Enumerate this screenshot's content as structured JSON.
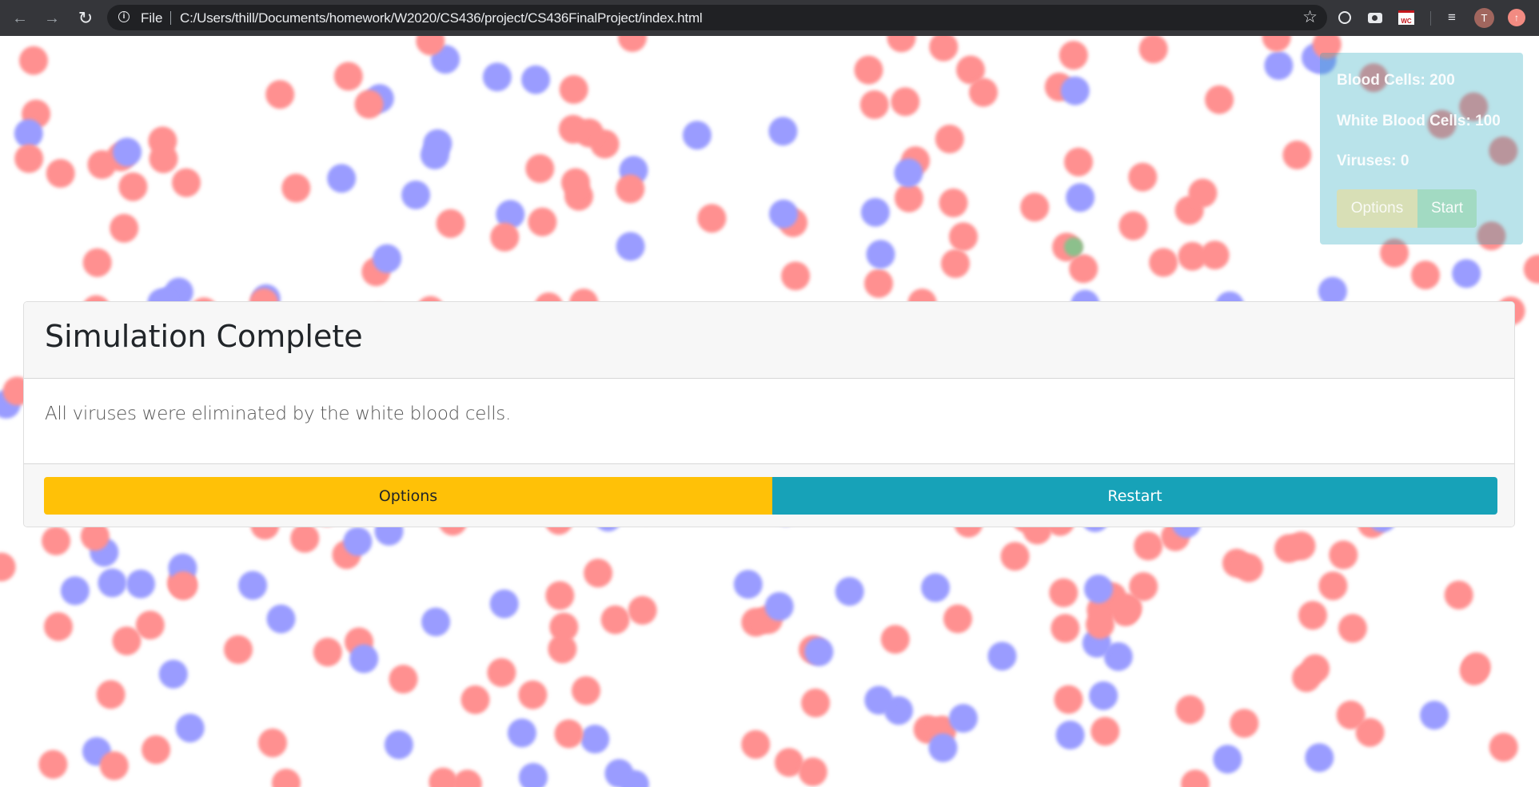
{
  "browser": {
    "scheme_label": "File",
    "url": "C:/Users/thill/Documents/homework/W2020/CS436/project/CS436FinalProject/index.html",
    "profile_initial": "T",
    "extensions": [
      "circle-extension-icon",
      "camera-icon",
      "wc-extension-icon",
      "media-control-icon"
    ]
  },
  "stats": {
    "blood_cells": "Blood Cells: 200",
    "white_blood_cells": "White Blood Cells: 100",
    "viruses": "Viruses: 0",
    "options_label": "Options",
    "start_label": "Start"
  },
  "dialog": {
    "title": "Simulation Complete",
    "message": "All viruses were eliminated by the white blood cells.",
    "options_label": "Options",
    "restart_label": "Restart"
  },
  "colors": {
    "red_blood_cell": "#ff9090",
    "white_blood_cell": "#9a9cff",
    "virus": "#8cc08c",
    "options_accent": "#ffc107",
    "restart_accent": "#17a2b8",
    "panel_accent": "#17a2b8"
  }
}
